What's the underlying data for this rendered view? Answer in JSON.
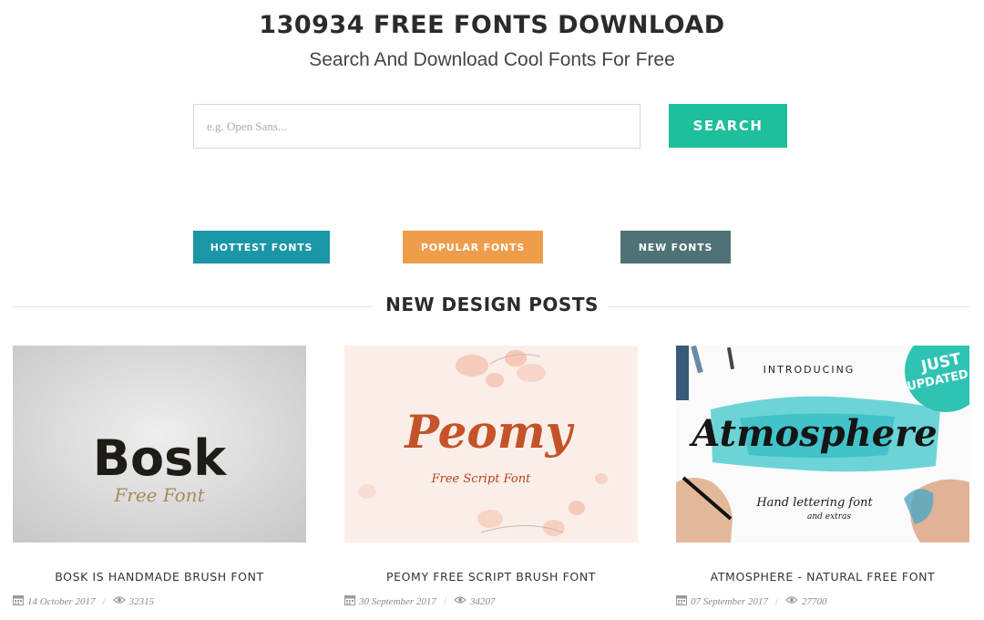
{
  "header": {
    "title": "130934 FREE FONTS DOWNLOAD",
    "subtitle": "Search And Download Cool Fonts For Free"
  },
  "search": {
    "placeholder": "e.g. Open Sans...",
    "value": "",
    "button_label": "SEARCH"
  },
  "categories": {
    "hottest": "HOTTEST FONTS",
    "popular": "POPULAR FONTS",
    "new": "NEW FONTS",
    "colors": {
      "hottest": "#1a96a6",
      "popular": "#ee9d4a",
      "new": "#4f7276",
      "search": "#1ebf9b"
    }
  },
  "section": {
    "title": "NEW DESIGN POSTS"
  },
  "posts": [
    {
      "title": "BOSK IS HANDMADE BRUSH FONT",
      "date": "14 October 2017",
      "views": "32315",
      "image": {
        "headline": "Bosk",
        "tagline": "Free Font"
      }
    },
    {
      "title": "PEOMY FREE SCRIPT BRUSH FONT",
      "date": "30 September 2017",
      "views": "34207",
      "image": {
        "headline": "Peomy",
        "tagline": "Free Script Font"
      }
    },
    {
      "title": "ATMOSPHERE - NATURAL FREE FONT",
      "date": "07 September 2017",
      "views": "27700",
      "image": {
        "headline": "Atmosphere",
        "intro": "INTRODUCING",
        "badge_line1": "JUST",
        "badge_line2": "UPDATED",
        "tagline": "Hand lettering font",
        "tagline2": "and extras"
      }
    }
  ],
  "icons": {
    "date": "calendar-icon",
    "views": "eye-icon"
  }
}
